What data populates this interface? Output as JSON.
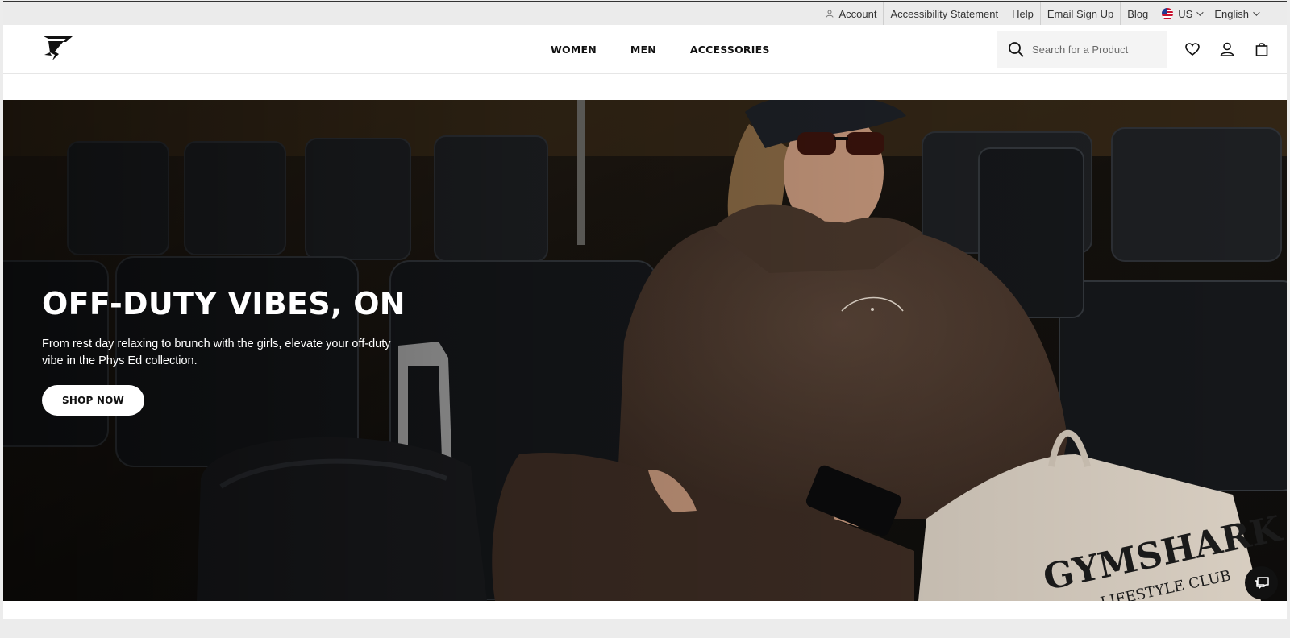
{
  "utility_bar": {
    "account": "Account",
    "accessibility": "Accessibility Statement",
    "help": "Help",
    "email_signup": "Email Sign Up",
    "blog": "Blog",
    "region": "US",
    "language": "English"
  },
  "header": {
    "logo_icon": "gymshark-logo-icon",
    "nav": [
      "WOMEN",
      "MEN",
      "ACCESSORIES"
    ],
    "search_placeholder": "Search for a Product",
    "icons": [
      "wishlist-heart-icon",
      "account-user-icon",
      "shopping-bag-icon"
    ]
  },
  "hero": {
    "title": "OFF-DUTY VIBES, ON",
    "subtitle": "From rest day relaxing to brunch with the girls, elevate your off-duty vibe in the Phys Ed collection.",
    "cta": "SHOP NOW"
  },
  "colors": {
    "utility_bg": "#ebebeb",
    "header_bg": "#ffffff",
    "hero_overlay_text": "#ffffff",
    "button_bg": "#ffffff",
    "chat_bg": "#111111"
  }
}
